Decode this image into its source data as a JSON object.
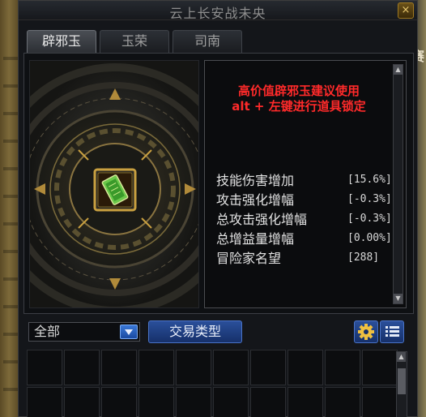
{
  "window": {
    "title": "云上长安战未央",
    "close_label": "×"
  },
  "tabs": [
    {
      "label": "辟邪玉",
      "active": true
    },
    {
      "label": "玉荣",
      "active": false
    },
    {
      "label": "司南",
      "active": false
    }
  ],
  "info": {
    "warning_line1": "高价值辟邪玉建议使用",
    "warning_line2": "alt + 左键进行道具锁定",
    "stats": [
      {
        "label": "技能伤害增加",
        "value": "[15.6%]"
      },
      {
        "label": "攻击强化增幅",
        "value": "[-0.3%]"
      },
      {
        "label": "总攻击强化增幅",
        "value": "[-0.3%]"
      },
      {
        "label": "总增益量增幅",
        "value": "[0.00%]"
      },
      {
        "label": "冒险家名望",
        "value": "[288]"
      }
    ]
  },
  "filter": {
    "dropdown_value": "全部",
    "trade_type_label": "交易类型"
  },
  "background": {
    "right_glyph": "赛"
  },
  "colors": {
    "warning": "#ff2a2a",
    "button_blue": "#2a4f9a",
    "gold": "#c9a040",
    "jade_green": "#6bc84a"
  },
  "icons": {
    "close": "close-icon",
    "dropdown": "chevron-down-icon",
    "gear": "gear-icon",
    "list": "list-icon",
    "item": "jade-card-icon"
  }
}
